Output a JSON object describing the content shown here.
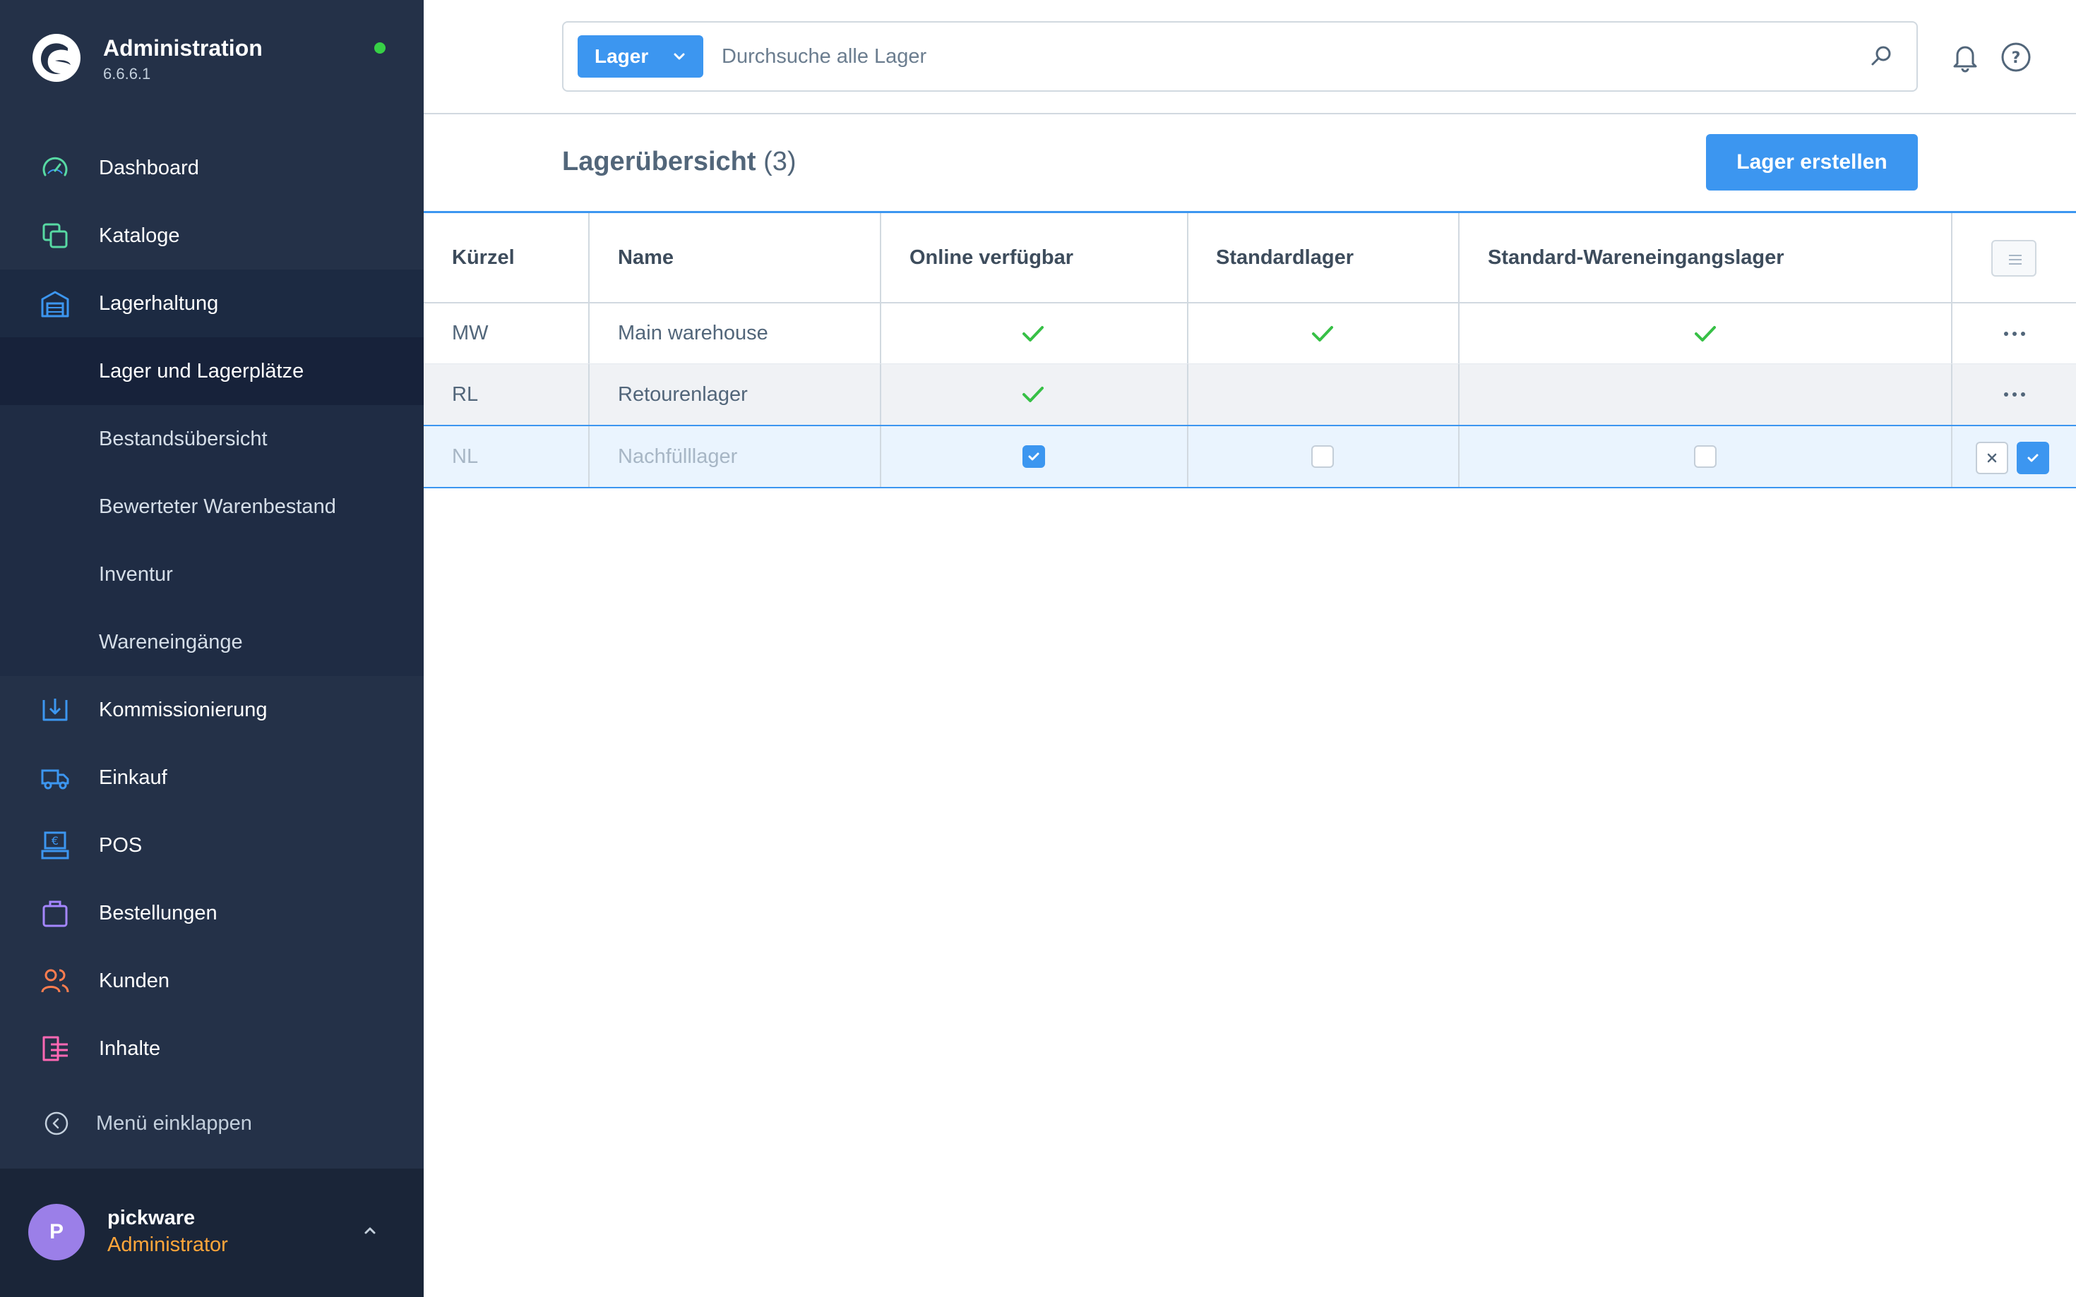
{
  "app": {
    "title": "Administration",
    "version": "6.6.6.1"
  },
  "sidebar": {
    "items": [
      {
        "label": "Dashboard",
        "icon": "gauge-icon"
      },
      {
        "label": "Kataloge",
        "icon": "catalog-icon"
      },
      {
        "label": "Lagerhaltung",
        "icon": "warehouse-icon"
      },
      {
        "label": "Kommissionierung",
        "icon": "picking-icon"
      },
      {
        "label": "Einkauf",
        "icon": "truck-icon"
      },
      {
        "label": "POS",
        "icon": "pos-icon"
      },
      {
        "label": "Bestellungen",
        "icon": "bag-icon"
      },
      {
        "label": "Kunden",
        "icon": "customers-icon"
      },
      {
        "label": "Inhalte",
        "icon": "content-icon"
      }
    ],
    "subitems": [
      {
        "label": "Lager und Lagerplätze"
      },
      {
        "label": "Bestandsübersicht"
      },
      {
        "label": "Bewerteter Warenbestand"
      },
      {
        "label": "Inventur"
      },
      {
        "label": "Wareneingänge"
      }
    ],
    "collapse_label": "Menü einklappen"
  },
  "user": {
    "initial": "P",
    "name": "pickware",
    "role": "Administrator"
  },
  "search": {
    "type_label": "Lager",
    "placeholder": "Durchsuche alle Lager"
  },
  "page": {
    "title": "Lagerübersicht",
    "count": "(3)",
    "create_label": "Lager erstellen"
  },
  "table": {
    "columns": [
      "Kürzel",
      "Name",
      "Online verfügbar",
      "Standardlager",
      "Standard-Wareneingangslager"
    ],
    "rows": [
      {
        "code": "MW",
        "name": "Main warehouse",
        "online": true,
        "default": true,
        "default_receiving": true
      },
      {
        "code": "RL",
        "name": "Retourenlager",
        "online": true,
        "default": false,
        "default_receiving": false
      }
    ],
    "edit_row": {
      "code": "NL",
      "name": "Nachfülllager",
      "online": true,
      "default": false,
      "default_receiving": false
    }
  },
  "colors": {
    "sidebar_bg": "#243148",
    "accent": "#3c96f0",
    "success": "#37c046",
    "user_role": "#ffa63a"
  }
}
